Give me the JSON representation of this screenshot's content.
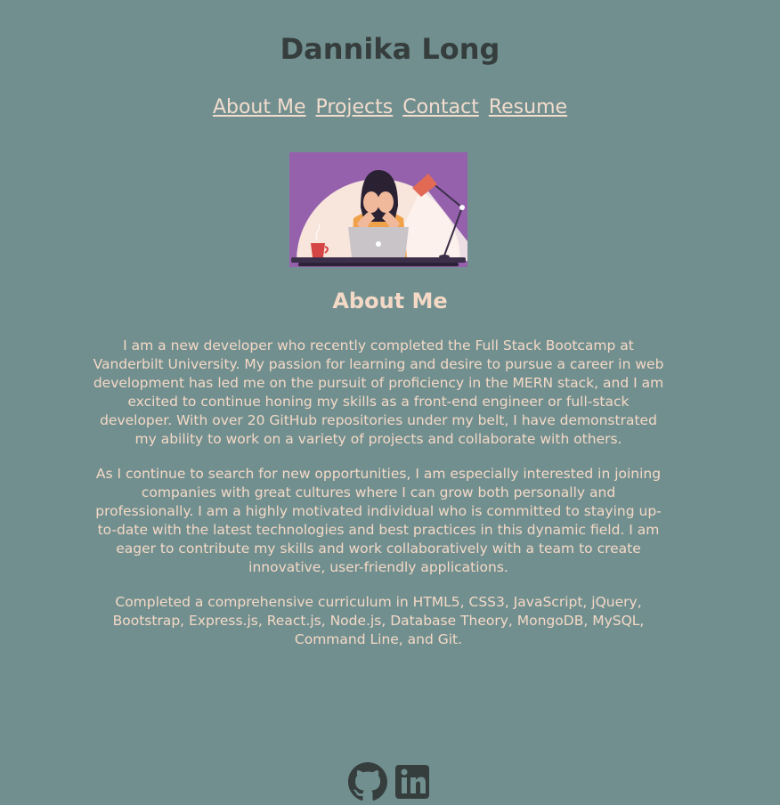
{
  "header": {
    "title": "Dannika Long"
  },
  "nav": {
    "items": [
      {
        "label": "About Me"
      },
      {
        "label": "Projects"
      },
      {
        "label": "Contact"
      },
      {
        "label": "Resume"
      }
    ]
  },
  "about": {
    "heading": "About Me",
    "paragraphs": [
      "I am a new developer who recently completed the Full Stack Bootcamp at Vanderbilt University. My passion for learning and desire to pursue a career in web development has led me on the pursuit of proficiency in the MERN stack, and I am excited to continue honing my skills as a front-end engineer or full-stack developer. With over 20 GitHub repositories under my belt, I have demonstrated my ability to work on a variety of projects and collaborate with others.",
      "As I continue to search for new opportunities, I am especially interested in joining companies with great cultures where I can grow both personally and professionally. I am a highly motivated individual who is committed to staying up-to-date with the latest technologies and best practices in this dynamic field. I am eager to contribute my skills and work collaboratively with a team to create innovative, user-friendly applications.",
      "Completed a comprehensive curriculum in HTML5, CSS3, JavaScript, jQuery, Bootstrap, Express.js, React.js, Node.js, Database Theory, MongoDB, MySQL, Command Line, and Git."
    ]
  },
  "socials": [
    {
      "icon": "github-icon"
    },
    {
      "icon": "linkedin-icon"
    }
  ],
  "colors": {
    "background": "#718f8f",
    "title": "#363d3d",
    "accent_text": "#f4d9c6",
    "illustration_bg": "#9561ad"
  }
}
